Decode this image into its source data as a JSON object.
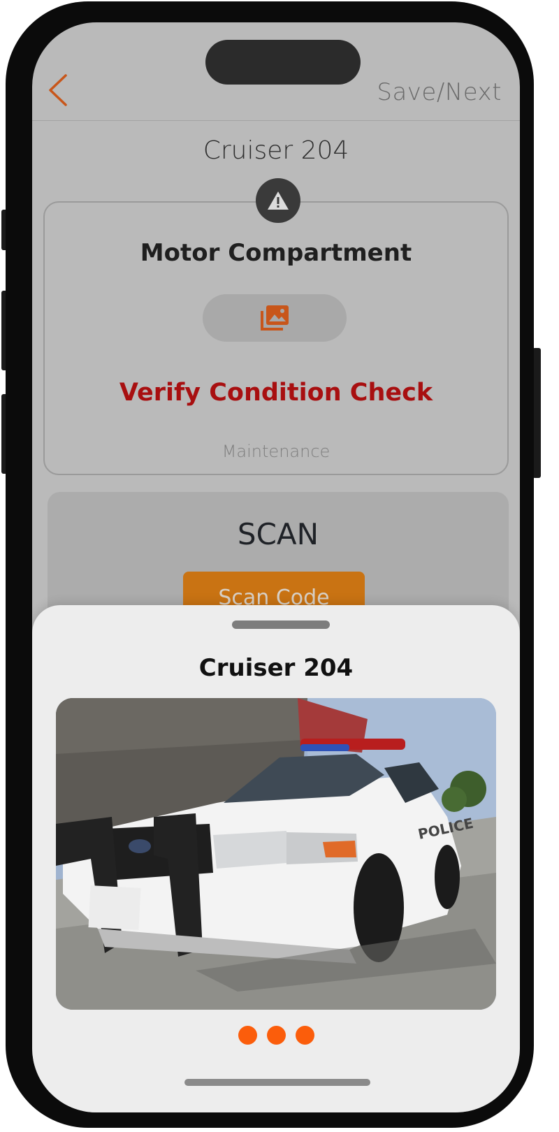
{
  "colors": {
    "accent": "#fb5d0b",
    "back_arrow": "#c8561a",
    "warning_text": "#a80f10",
    "scan_button": "#c97313",
    "screen_dim": "#bababa",
    "sheet_bg": "#ededed"
  },
  "nav": {
    "back_icon": "chevron-left-icon",
    "save_next_label": "Save/Next"
  },
  "vehicle": {
    "title": "Cruiser 204"
  },
  "check_card": {
    "badge_icon": "warning-icon",
    "title": "Motor Compartment",
    "photo_icon": "photo-library-icon",
    "status": "Verify Condition Check",
    "category": "Maintenance"
  },
  "scan": {
    "title": "SCAN",
    "button_label": "Scan Code"
  },
  "sheet": {
    "title": "Cruiser 204",
    "image_icon": "police-car-photo",
    "image_lettering": "POLICE",
    "page_dots": 3
  }
}
